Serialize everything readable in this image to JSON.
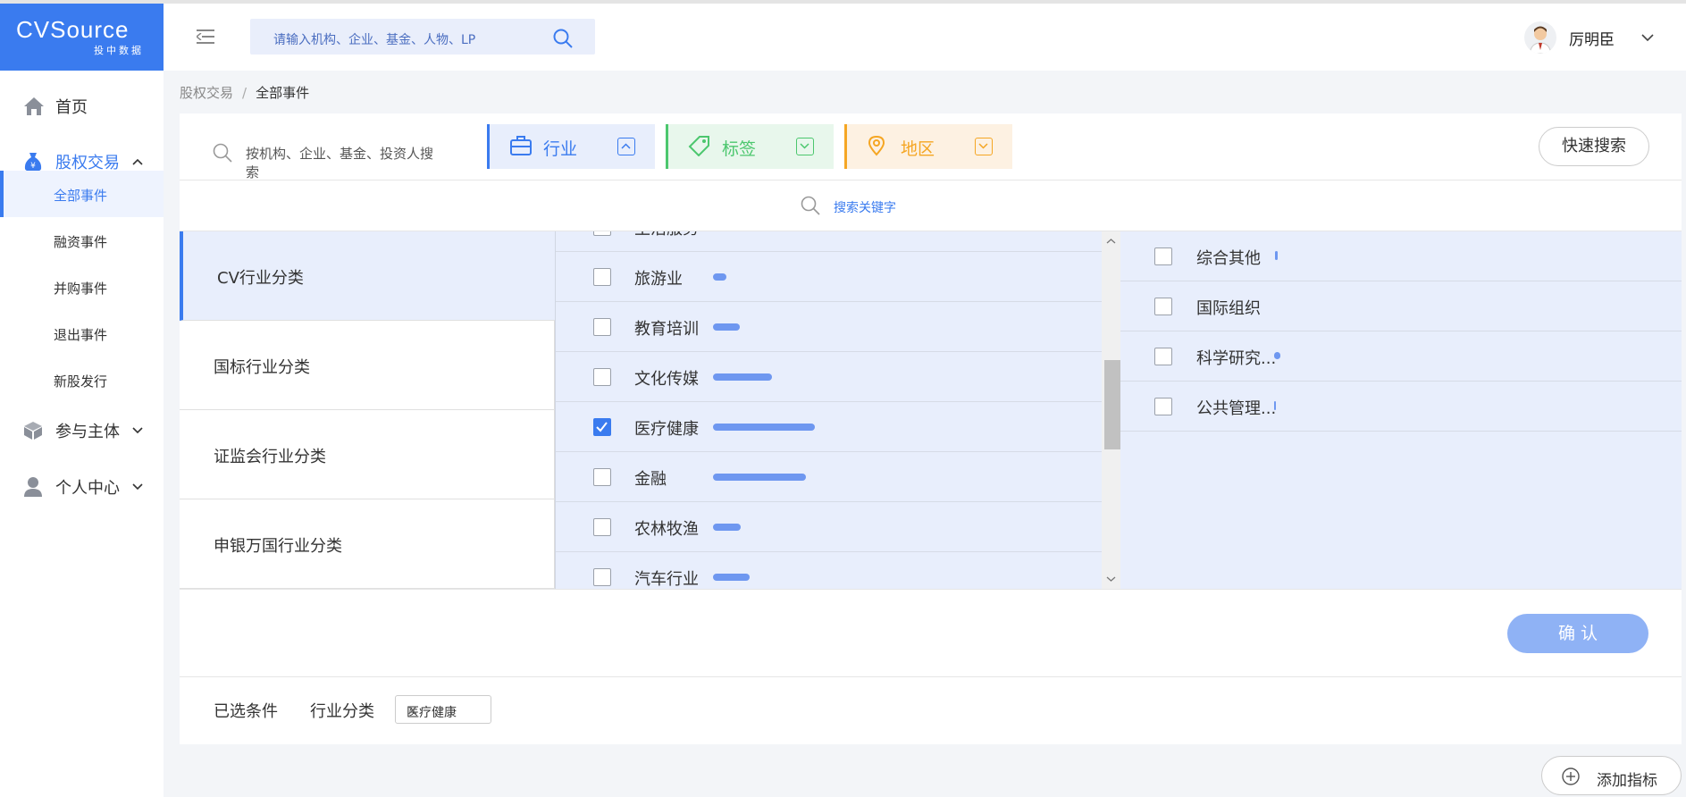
{
  "logo": {
    "brand": "CVSource",
    "sub": "投中数据"
  },
  "header": {
    "search_placeholder": "请输入机构、企业、基金、人物、LP",
    "user_name": "厉明臣"
  },
  "sidebar": {
    "items": [
      {
        "label": "首页",
        "icon": "home-icon"
      },
      {
        "label": "股权交易",
        "icon": "money-bag-icon"
      },
      {
        "label": "参与主体",
        "icon": "cube-icon"
      },
      {
        "label": "个人中心",
        "icon": "person-icon"
      }
    ],
    "sub_items": [
      "全部事件",
      "融资事件",
      "并购事件",
      "退出事件",
      "新股发行"
    ]
  },
  "breadcrumb": {
    "parent": "股权交易",
    "separator": "/",
    "current": "全部事件"
  },
  "filter": {
    "search_placeholder": "按机构、企业、基金、投资人搜索",
    "tabs": [
      {
        "label": "行业",
        "icon": "briefcase-icon",
        "color": "#3a7bef"
      },
      {
        "label": "标签",
        "icon": "tag-icon",
        "color": "#4cc76e"
      },
      {
        "label": "地区",
        "icon": "location-pin-icon",
        "color": "#f5a623"
      }
    ],
    "quick_search": "快速搜索",
    "keyword_search": "搜索关键字"
  },
  "categories": [
    "CV行业分类",
    "国标行业分类",
    "证监会行业分类",
    "申银万国行业分类"
  ],
  "industries": [
    {
      "label": "生活服务",
      "checked": false,
      "share": 0.05
    },
    {
      "label": "旅游业",
      "checked": false,
      "share": 0.13
    },
    {
      "label": "教育培训",
      "checked": false,
      "share": 0.26
    },
    {
      "label": "文化传媒",
      "checked": false,
      "share": 0.58
    },
    {
      "label": "医疗健康",
      "checked": true,
      "share": 1.0
    },
    {
      "label": "金融",
      "checked": false,
      "share": 0.91
    },
    {
      "label": "农林牧渔",
      "checked": false,
      "share": 0.27
    },
    {
      "label": "汽车行业",
      "checked": false,
      "share": 0.36
    }
  ],
  "sub_industries": [
    {
      "label": "综合其他",
      "checked": false
    },
    {
      "label": "国际组织",
      "checked": false
    },
    {
      "label": "科学研究...",
      "checked": false
    },
    {
      "label": "公共管理...",
      "checked": false
    }
  ],
  "confirm_label": "确 认",
  "selected": {
    "label": "已选条件",
    "group": "行业分类",
    "chip": "医疗健康"
  },
  "add_metric": "添加指标"
}
